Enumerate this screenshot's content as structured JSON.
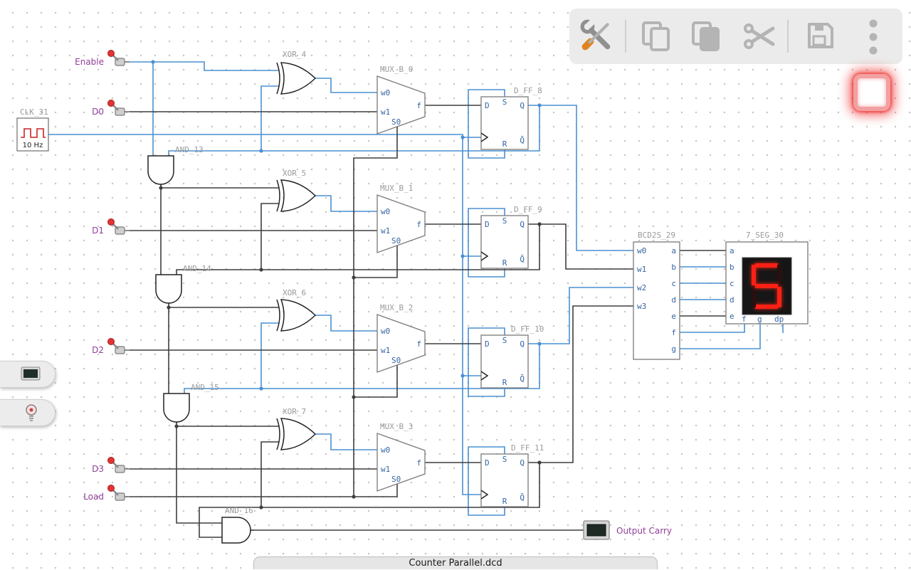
{
  "window": {
    "file_tab": "Counter Parallel.dcd"
  },
  "toolbar": {
    "buttons": [
      {
        "name": "customise",
        "icon": "wrench-screwdriver-icon"
      },
      {
        "name": "copy",
        "icon": "copy-icon"
      },
      {
        "name": "paste",
        "icon": "paste-icon"
      },
      {
        "name": "cut",
        "icon": "scissors-icon"
      },
      {
        "name": "save",
        "icon": "floppy-disk-icon"
      },
      {
        "name": "menu",
        "icon": "kebab-menu-icon"
      }
    ],
    "stop_icon": "stop-simulation-button"
  },
  "palette": {
    "items": [
      {
        "icon": "display-icon"
      },
      {
        "icon": "bulb-icon"
      }
    ]
  },
  "clock": {
    "name": "CLK_31",
    "frequency": "10 Hz"
  },
  "io": {
    "enable": "Enable",
    "d0": "D0",
    "d1": "D1",
    "d2": "D2",
    "d3": "D3",
    "load": "Load",
    "output": "Output Carry"
  },
  "gates": {
    "xor": [
      "XOR_4",
      "XOR_5",
      "XOR_6",
      "XOR_7"
    ],
    "and": [
      "AND_13",
      "AND_14",
      "AND_15",
      "AND_16"
    ]
  },
  "mux": {
    "names": [
      "MUX_B_0",
      "MUX_B_1",
      "MUX_B_2",
      "MUX_B_3"
    ],
    "pins": {
      "in0": "w0",
      "in1": "w1",
      "sel": "S0",
      "out": "f"
    }
  },
  "flipflops": {
    "names": [
      "D_FF_8",
      "D_FF_9",
      "D_FF_10",
      "D_FF_11"
    ],
    "pins": {
      "d": "D",
      "s": "S",
      "q": "Q",
      "r": "R",
      "qn": "Q̄"
    }
  },
  "decoder": {
    "name": "BCD2S_29",
    "inputs": [
      "w0",
      "w1",
      "w2",
      "w3"
    ],
    "outputs": [
      "a",
      "b",
      "c",
      "d",
      "e",
      "f",
      "g"
    ]
  },
  "display7": {
    "name": "7_SEG_30",
    "value": "5",
    "segments_lit": [
      "a",
      "c",
      "d",
      "f",
      "g"
    ],
    "left_pins": [
      "a",
      "b",
      "c",
      "d",
      "e"
    ],
    "bottom_pins": [
      "f",
      "g",
      "dp"
    ]
  },
  "colors": {
    "wire_on": "#4a90d2",
    "wire_off": "#3f3f3f",
    "label": "#9a9a9a",
    "pin": "#3465a4",
    "io_label": "#8f3f97",
    "segment_on": "#ff2015",
    "accent_red": "#ef2929"
  }
}
